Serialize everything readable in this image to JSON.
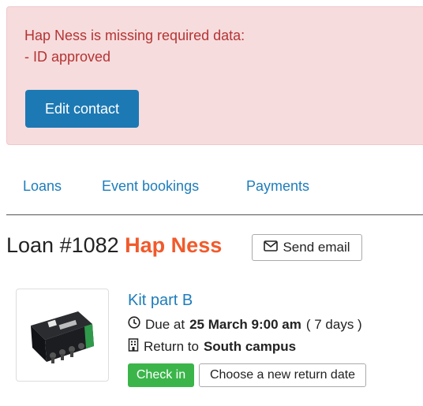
{
  "alert": {
    "message_line1": "Hap Ness is missing required data:",
    "message_line2": "- ID approved",
    "edit_contact_label": "Edit contact"
  },
  "tabs": [
    {
      "label": "Loans"
    },
    {
      "label": "Event bookings"
    },
    {
      "label": "Payments"
    }
  ],
  "loan": {
    "title_prefix": "Loan #1082",
    "contact_name": "Hap Ness",
    "send_email_label": "Send email"
  },
  "item": {
    "name": "Kit part B",
    "due_prefix": "Due at",
    "due_date": "25 March 9:00 am",
    "due_duration": "( 7 days )",
    "return_prefix": "Return to",
    "return_location": "South campus",
    "check_in_label": "Check in",
    "new_return_date_label": "Choose a new return date"
  },
  "colors": {
    "alert_bg": "#f6dcdd",
    "alert_text": "#b53434",
    "primary": "#1d79b4",
    "link": "#1d7dbb",
    "contact_name": "#f15a2b",
    "success": "#3bb54a"
  },
  "icons": {
    "send_email": "envelope-icon",
    "due": "clock-icon",
    "return": "building-icon"
  }
}
